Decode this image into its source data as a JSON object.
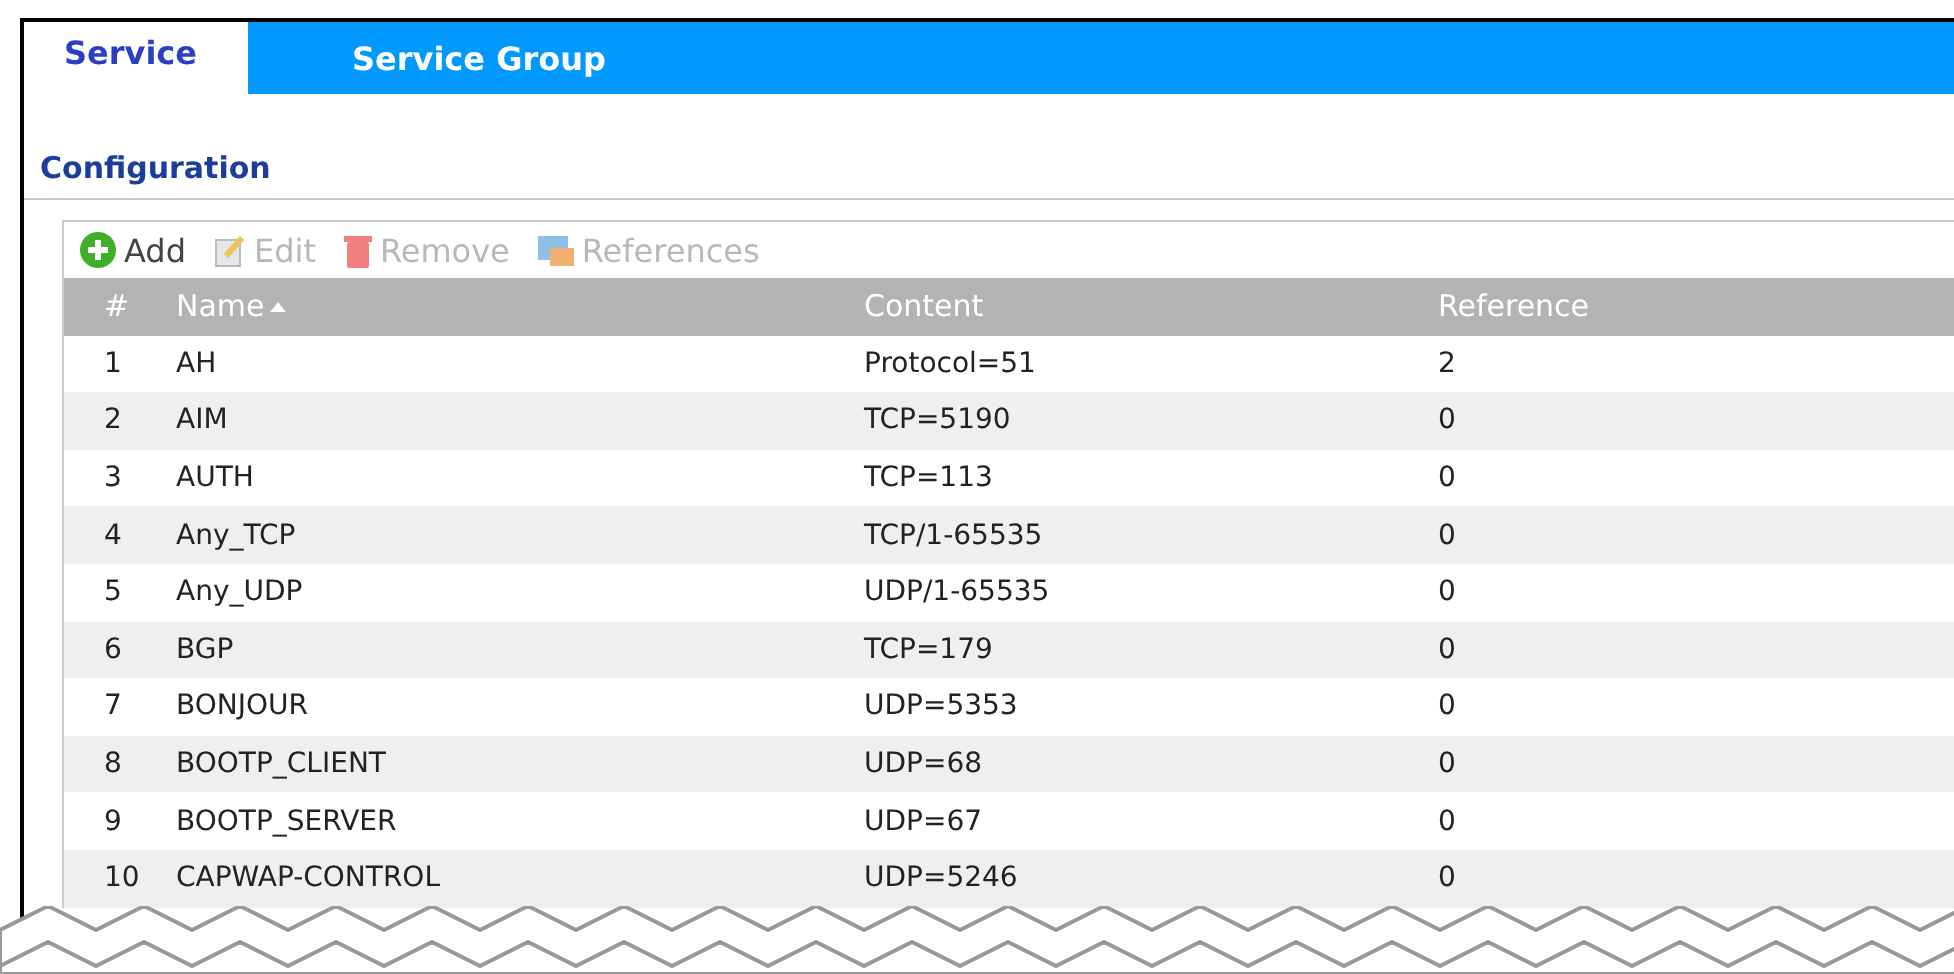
{
  "tabs": [
    {
      "label": "Service",
      "selected": true
    },
    {
      "label": "Service Group",
      "selected": false
    }
  ],
  "section_title": "Configuration",
  "toolbar": [
    {
      "label": "Add",
      "kind": "add",
      "disabled": false
    },
    {
      "label": "Edit",
      "kind": "edit",
      "disabled": true
    },
    {
      "label": "Remove",
      "kind": "remove",
      "disabled": true
    },
    {
      "label": "References",
      "kind": "references",
      "disabled": true
    }
  ],
  "table": {
    "columns": [
      {
        "label": "#",
        "sorted": false
      },
      {
        "label": "Name",
        "sorted": true
      },
      {
        "label": "Content",
        "sorted": false
      },
      {
        "label": "Reference",
        "sorted": false
      }
    ],
    "rows": [
      [
        "1",
        "AH",
        "Protocol=51",
        "2"
      ],
      [
        "2",
        "AIM",
        "TCP=5190",
        "0"
      ],
      [
        "3",
        "AUTH",
        "TCP=113",
        "0"
      ],
      [
        "4",
        "Any_TCP",
        "TCP/1-65535",
        "0"
      ],
      [
        "5",
        "Any_UDP",
        "UDP/1-65535",
        "0"
      ],
      [
        "6",
        "BGP",
        "TCP=179",
        "0"
      ],
      [
        "7",
        "BONJOUR",
        "UDP=5353",
        "0"
      ],
      [
        "8",
        "BOOTP_CLIENT",
        "UDP=68",
        "0"
      ],
      [
        "9",
        "BOOTP_SERVER",
        "UDP=67",
        "0"
      ],
      [
        "10",
        "CAPWAP-CONTROL",
        "UDP=5246",
        "0"
      ]
    ]
  }
}
